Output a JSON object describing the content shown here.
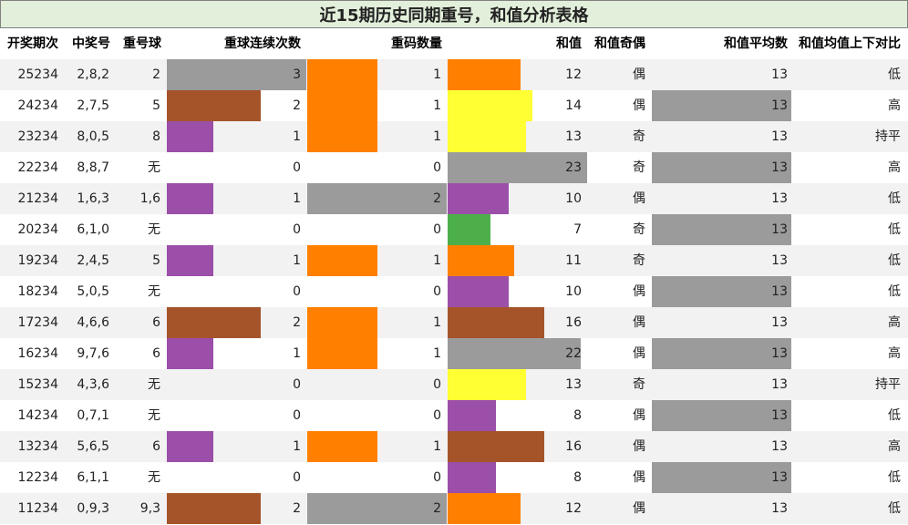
{
  "title": "近15期历史同期重号，和值分析表格",
  "headers": {
    "period": "开奖期次",
    "numbers": "中奖号",
    "repeat_ball": "重号球",
    "consecutive": "重球连续次数",
    "repeat_count": "重码数量",
    "sum": "和值",
    "parity": "和值奇偶",
    "sum_avg": "和值平均数",
    "compare": "和值均值上下对比"
  },
  "colors": {
    "title_bg": "#e2efda",
    "gray": "#9b9b9b",
    "orange": "#ff8000",
    "brown": "#a5542a",
    "purple": "#9b4fa8",
    "yellow": "#ffff33",
    "green": "#4daf4a",
    "alt_row": "#f2f2f2"
  },
  "rows": [
    {
      "period": "25234",
      "numbers": "2,8,2",
      "repeat_ball": "2",
      "consecutive": "3",
      "repeat_count": "1",
      "sum": "12",
      "parity": "偶",
      "avg": "13",
      "compare": "低"
    },
    {
      "period": "24234",
      "numbers": "2,7,5",
      "repeat_ball": "5",
      "consecutive": "2",
      "repeat_count": "1",
      "sum": "14",
      "parity": "偶",
      "avg": "13",
      "compare": "高"
    },
    {
      "period": "23234",
      "numbers": "8,0,5",
      "repeat_ball": "8",
      "consecutive": "1",
      "repeat_count": "1",
      "sum": "13",
      "parity": "奇",
      "avg": "13",
      "compare": "持平"
    },
    {
      "period": "22234",
      "numbers": "8,8,7",
      "repeat_ball": "无",
      "consecutive": "0",
      "repeat_count": "0",
      "sum": "23",
      "parity": "奇",
      "avg": "13",
      "compare": "高"
    },
    {
      "period": "21234",
      "numbers": "1,6,3",
      "repeat_ball": "1,6",
      "consecutive": "1",
      "repeat_count": "2",
      "sum": "10",
      "parity": "偶",
      "avg": "13",
      "compare": "低"
    },
    {
      "period": "20234",
      "numbers": "6,1,0",
      "repeat_ball": "无",
      "consecutive": "0",
      "repeat_count": "0",
      "sum": "7",
      "parity": "奇",
      "avg": "13",
      "compare": "低"
    },
    {
      "period": "19234",
      "numbers": "2,4,5",
      "repeat_ball": "5",
      "consecutive": "1",
      "repeat_count": "1",
      "sum": "11",
      "parity": "奇",
      "avg": "13",
      "compare": "低"
    },
    {
      "period": "18234",
      "numbers": "5,0,5",
      "repeat_ball": "无",
      "consecutive": "0",
      "repeat_count": "0",
      "sum": "10",
      "parity": "偶",
      "avg": "13",
      "compare": "低"
    },
    {
      "period": "17234",
      "numbers": "4,6,6",
      "repeat_ball": "6",
      "consecutive": "2",
      "repeat_count": "1",
      "sum": "16",
      "parity": "偶",
      "avg": "13",
      "compare": "高"
    },
    {
      "period": "16234",
      "numbers": "9,7,6",
      "repeat_ball": "6",
      "consecutive": "1",
      "repeat_count": "1",
      "sum": "22",
      "parity": "偶",
      "avg": "13",
      "compare": "高"
    },
    {
      "period": "15234",
      "numbers": "4,3,6",
      "repeat_ball": "无",
      "consecutive": "0",
      "repeat_count": "0",
      "sum": "13",
      "parity": "奇",
      "avg": "13",
      "compare": "持平"
    },
    {
      "period": "14234",
      "numbers": "0,7,1",
      "repeat_ball": "无",
      "consecutive": "0",
      "repeat_count": "0",
      "sum": "8",
      "parity": "偶",
      "avg": "13",
      "compare": "低"
    },
    {
      "period": "13234",
      "numbers": "5,6,5",
      "repeat_ball": "6",
      "consecutive": "1",
      "repeat_count": "1",
      "sum": "16",
      "parity": "偶",
      "avg": "13",
      "compare": "高"
    },
    {
      "period": "12234",
      "numbers": "6,1,1",
      "repeat_ball": "无",
      "consecutive": "0",
      "repeat_count": "0",
      "sum": "8",
      "parity": "偶",
      "avg": "13",
      "compare": "低"
    },
    {
      "period": "11234",
      "numbers": "0,9,3",
      "repeat_ball": "9,3",
      "consecutive": "2",
      "repeat_count": "2",
      "sum": "12",
      "parity": "偶",
      "avg": "13",
      "compare": "低"
    }
  ]
}
